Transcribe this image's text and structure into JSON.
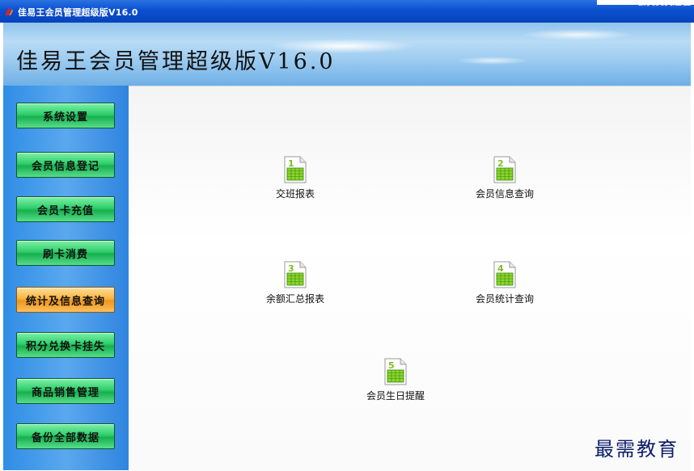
{
  "window": {
    "title": "佳易王会员管理超级版V16.0",
    "right_caption": "会员费员超佳"
  },
  "banner": {
    "title": "佳易王会员管理超级版V16.0"
  },
  "sidebar": {
    "items": [
      {
        "label": "系统设置",
        "active": false
      },
      {
        "label": "会员信息登记",
        "active": false
      },
      {
        "label": "会员卡充值",
        "active": false
      },
      {
        "label": "刷卡消费",
        "active": false
      },
      {
        "label": "统计及信息查询",
        "active": true
      },
      {
        "label": "积分兑换卡挂失",
        "active": false
      },
      {
        "label": "商品销售管理",
        "active": false
      },
      {
        "label": "备份全部数据",
        "active": false
      }
    ]
  },
  "reports": [
    {
      "number": "1",
      "label": "交班报表",
      "icon": "spreadsheet-icon"
    },
    {
      "number": "2",
      "label": "会员信息查询",
      "icon": "spreadsheet-icon"
    },
    {
      "number": "3",
      "label": "余额汇总报表",
      "icon": "spreadsheet-icon"
    },
    {
      "number": "4",
      "label": "会员统计查询",
      "icon": "spreadsheet-icon"
    },
    {
      "number": "5",
      "label": "会员生日提醒",
      "icon": "spreadsheet-icon"
    }
  ],
  "watermark": "最需教育",
  "colors": {
    "titlebar": "#0a4fd0",
    "sidebar": "#2f8de6",
    "nav_button": "#2fcf6b",
    "nav_button_active": "#f8b440",
    "watermark": "#0d1d6a"
  }
}
